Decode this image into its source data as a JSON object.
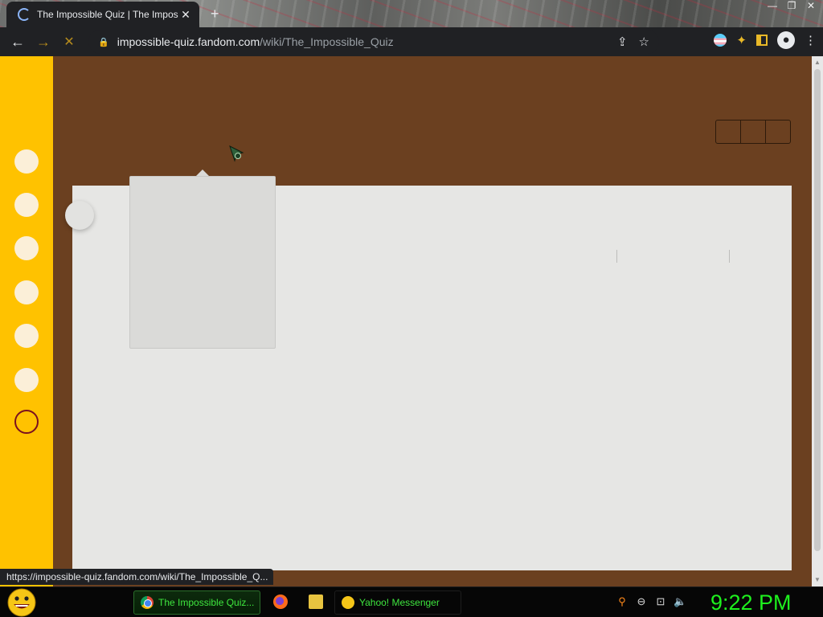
{
  "browser": {
    "tab_title": "The Impossible Quiz | The Impos",
    "tab_close": "✕",
    "new_tab": "+",
    "window_controls": [
      "—",
      "❐",
      "✕"
    ],
    "url_host": "impossible-quiz.fandom.com",
    "url_path": "/wiki/The_Impossible_Quiz",
    "back_icon": "←",
    "forward_icon": "→",
    "stop_icon": "✕",
    "share_icon": "⇪",
    "star_icon": "☆",
    "menu_icon": "⋮"
  },
  "page": {
    "background_color": "#6b4020",
    "sidebar_color": "#ffc200",
    "card_color": "#e6e6e4",
    "rail_items": [
      "",
      "",
      "",
      "",
      "",
      ""
    ],
    "status_url": "https://impossible-quiz.fandom.com/wiki/The_Impossible_Q..."
  },
  "taskbar": {
    "chrome_task_label": "The Impossible Quiz...",
    "yahoo_task_label": "Yahoo! Messenger",
    "clock": "9:22 PM",
    "tray_icons": [
      "search-icon",
      "minus-circle-icon",
      "network-icon",
      "volume-icon"
    ]
  }
}
